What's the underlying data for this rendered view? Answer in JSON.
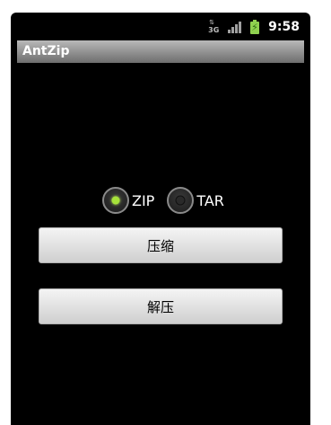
{
  "status_bar": {
    "network_label": "3G",
    "time": "9:58",
    "icons": [
      "network-3g-icon",
      "signal-icon",
      "battery-charging-icon"
    ]
  },
  "app": {
    "title": "AntZip"
  },
  "radio_options": [
    {
      "label": "ZIP",
      "selected": true
    },
    {
      "label": "TAR",
      "selected": false
    }
  ],
  "buttons": {
    "compress": "压缩",
    "extract": "解压"
  },
  "colors": {
    "background": "#000000",
    "radio_selected": "#a6e23a",
    "battery": "#8fd14f"
  }
}
